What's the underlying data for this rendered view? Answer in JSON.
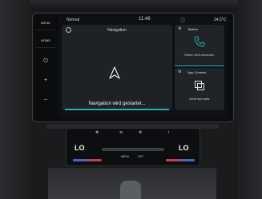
{
  "status_bar": {
    "profile": "Normal",
    "time": "11:46",
    "info_icon": "info-icon",
    "temperature": "24.5°C"
  },
  "side_buttons": {
    "menu": "MENU",
    "home": "HOME",
    "power_icon": "power-icon",
    "volume_up_icon": "plus-icon",
    "volume_down_icon": "minus-icon"
  },
  "navigation": {
    "title": "Navigation",
    "message": "Navigation wird gestartet..."
  },
  "telefon": {
    "title": "Telefon",
    "status": "Telefon nicht verbunden."
  },
  "app_connect": {
    "title": "App-Connect",
    "status": "Gerät nicht aktiv."
  },
  "climate": {
    "left_temp": "LO",
    "right_temp": "LO",
    "menu_label": "MENU",
    "off_label": "OFF",
    "sync_label": "SYNC"
  },
  "colors": {
    "accent": "#1fb3b2",
    "warm": "#e63232",
    "cool": "#2a6ee8"
  }
}
